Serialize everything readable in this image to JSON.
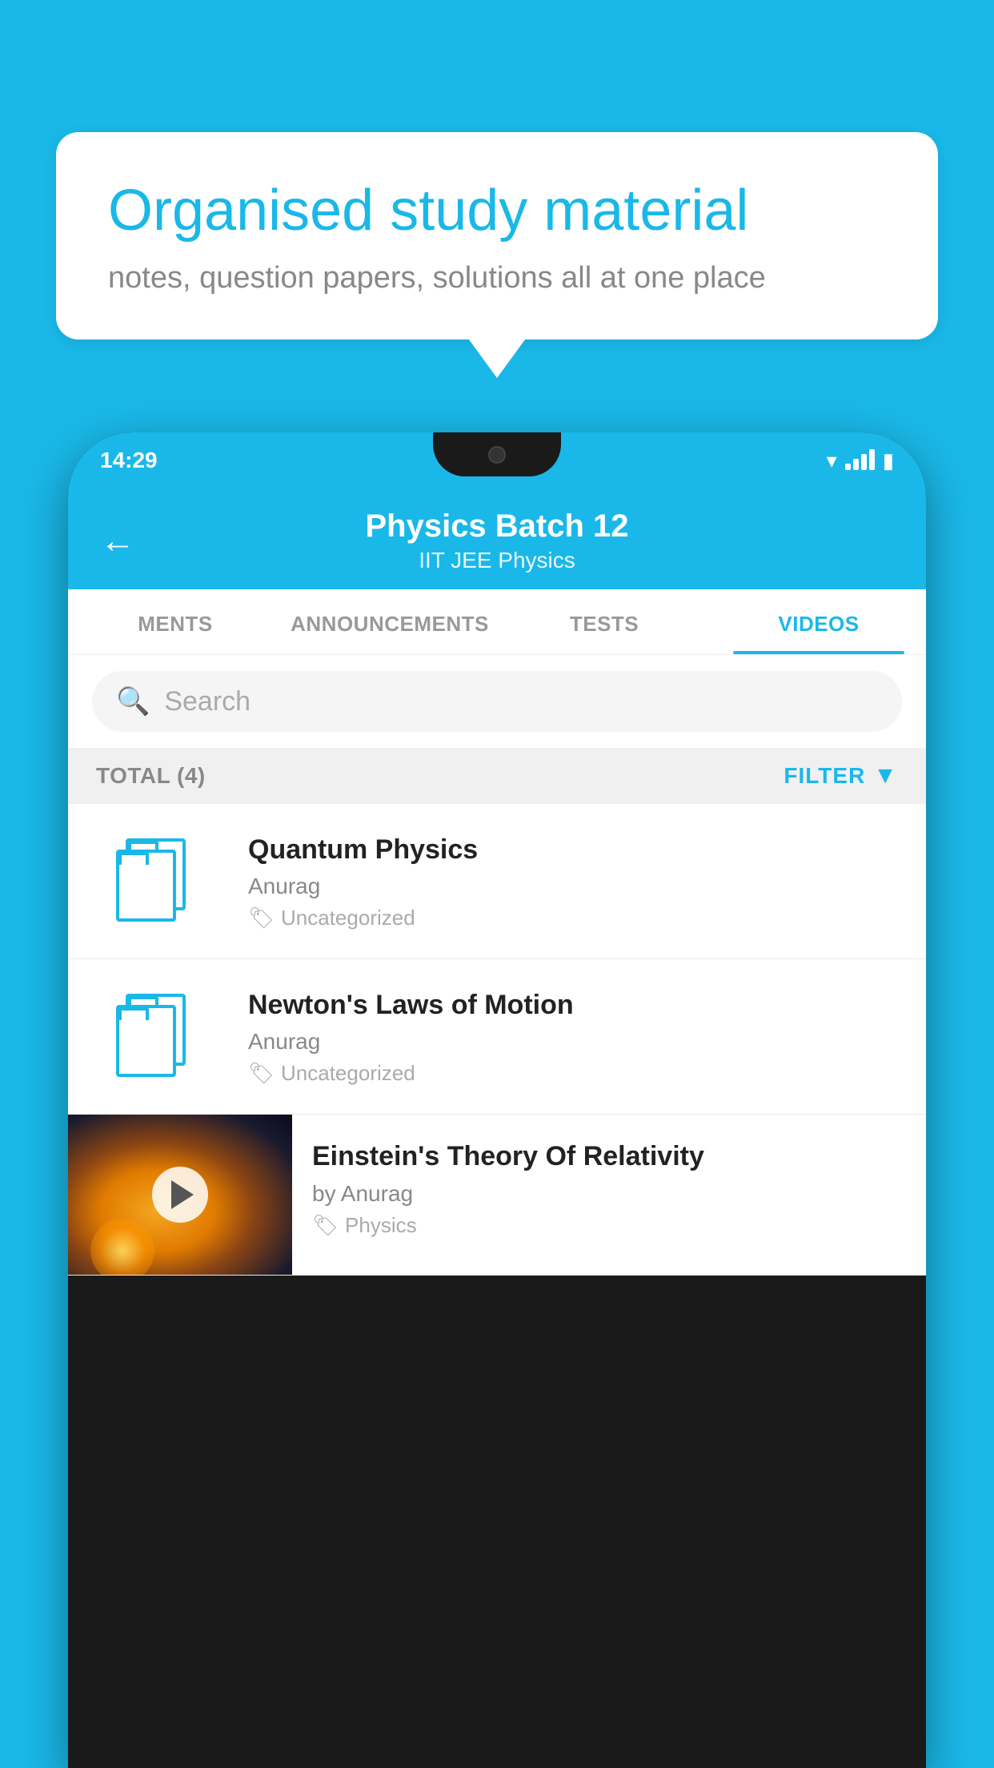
{
  "background_color": "#1ab8e8",
  "speech_bubble": {
    "title": "Organised study material",
    "subtitle": "notes, question papers, solutions all at one place"
  },
  "status_bar": {
    "time": "14:29"
  },
  "app_header": {
    "title": "Physics Batch 12",
    "subtitle": "IIT JEE   Physics",
    "back_label": "←"
  },
  "tabs": [
    {
      "label": "MENTS",
      "active": false
    },
    {
      "label": "ANNOUNCEMENTS",
      "active": false
    },
    {
      "label": "TESTS",
      "active": false
    },
    {
      "label": "VIDEOS",
      "active": true
    }
  ],
  "search": {
    "placeholder": "Search"
  },
  "filter_bar": {
    "total_label": "TOTAL (4)",
    "filter_label": "FILTER"
  },
  "video_items": [
    {
      "title": "Quantum Physics",
      "author": "Anurag",
      "tag": "Uncategorized",
      "has_thumb": false
    },
    {
      "title": "Newton's Laws of Motion",
      "author": "Anurag",
      "tag": "Uncategorized",
      "has_thumb": false
    },
    {
      "title": "Einstein's Theory Of Relativity",
      "author": "by Anurag",
      "tag": "Physics",
      "has_thumb": true
    }
  ]
}
